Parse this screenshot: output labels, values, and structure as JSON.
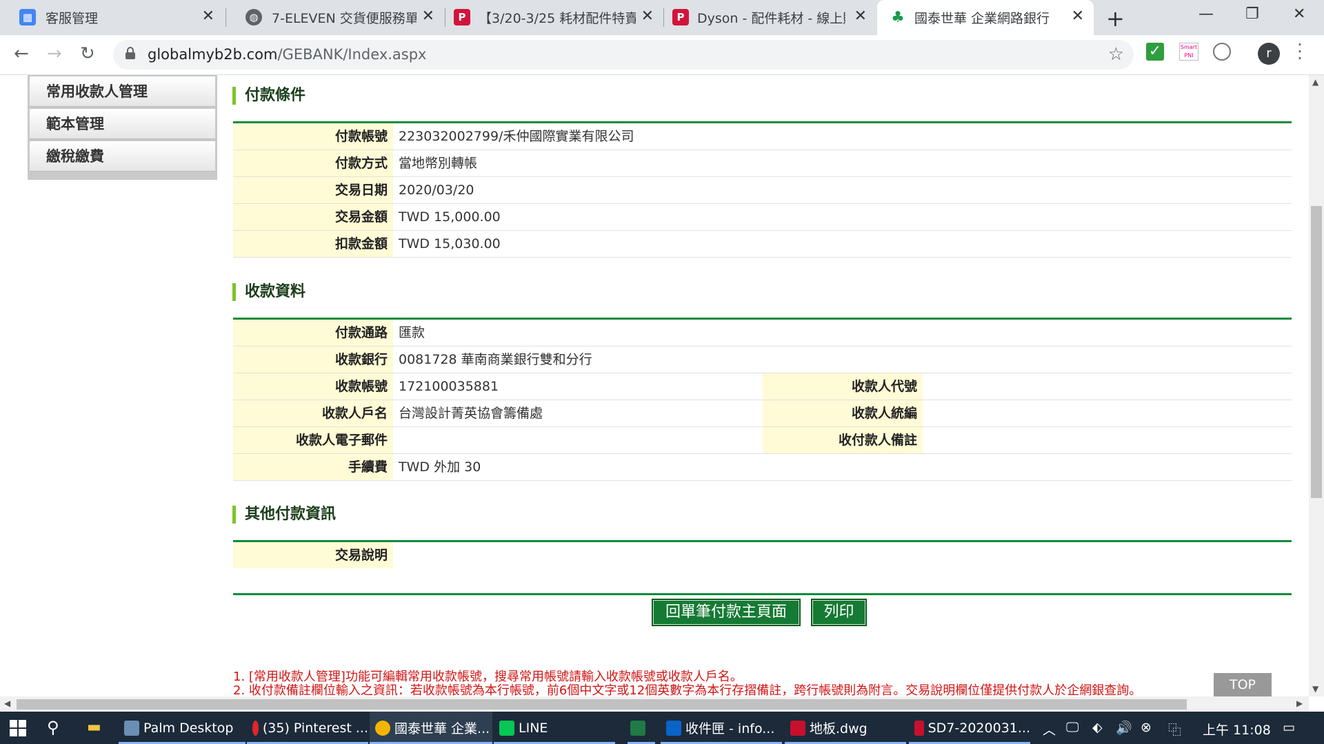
{
  "browser": {
    "tabs": [
      {
        "title": "客服管理",
        "favicon": "calendar-icon",
        "color": "#4285f4"
      },
      {
        "title": "7-ELEVEN 交貨便服務單",
        "favicon": "globe-icon",
        "color": "#5f6368"
      },
      {
        "title": "【3/20-3/25 耗材配件特賣",
        "favicon": "p-logo-icon",
        "color": "#d2143a"
      },
      {
        "title": "Dyson - 配件耗材 - 線上購",
        "favicon": "p-logo-icon",
        "color": "#d2143a"
      },
      {
        "title": "國泰世華 企業網路銀行",
        "favicon": "tree-logo-icon",
        "color": "#1a9b4a",
        "active": true
      }
    ],
    "url_host": "globalmyb2b.com",
    "url_path": "/GEBANK/Index.aspx",
    "avatar_letter": "r",
    "smart_ext": "Smart PNI"
  },
  "sidebar": {
    "items": [
      "常用收款人管理",
      "範本管理",
      "繳稅繳費"
    ]
  },
  "payment_terms": {
    "title": "付款條件",
    "rows": [
      {
        "label": "付款帳號",
        "value": "223032002799/禾仲國際實業有限公司"
      },
      {
        "label": "付款方式",
        "value": "當地幣別轉帳"
      },
      {
        "label": "交易日期",
        "value": "2020/03/20"
      },
      {
        "label": "交易金額",
        "value": "TWD 15,000.00"
      },
      {
        "label": "扣款金額",
        "value": "TWD 15,030.00"
      }
    ]
  },
  "payee_info": {
    "title": "收款資料",
    "channel": {
      "label": "付款通路",
      "value": "匯款"
    },
    "bank": {
      "label": "收款銀行",
      "value": "0081728 華南商業銀行雙和分行"
    },
    "account": {
      "label": "收款帳號",
      "value": "172100035881"
    },
    "payee_code": {
      "label": "收款人代號",
      "value": ""
    },
    "name": {
      "label": "收款人戶名",
      "value": "台灣設計菁英協會籌備處"
    },
    "tax_id": {
      "label": "收款人統編",
      "value": ""
    },
    "email": {
      "label": "收款人電子郵件",
      "value": ""
    },
    "remark": {
      "label": "收付款人備註",
      "value": ""
    },
    "fee": {
      "label": "手續費",
      "value": "TWD 外加 30"
    }
  },
  "other_info": {
    "title": "其他付款資訊",
    "desc": {
      "label": "交易說明",
      "value": ""
    }
  },
  "buttons": {
    "back": "回單筆付款主頁面",
    "print": "列印",
    "top": "TOP"
  },
  "notes": [
    "1. [常用收款人管理]功能可編輯常用收款帳號，搜尋常用帳號請輸入收款帳號或收款人戶名。",
    "2. 收付款備註欄位輸入之資訊：若收款帳號為本行帳號，前6個中文字或12個英數字為本行存摺備註，跨行帳號則為附言。交易說明欄位僅提供付款人於企網銀查詢。"
  ],
  "taskbar": {
    "items": [
      {
        "label": "Palm Desktop",
        "icon": "palm-icon",
        "color": "#6a8fb5"
      },
      {
        "label": "(35) Pinterest ...",
        "icon": "opera-icon",
        "color": "#e0262e"
      },
      {
        "label": "國泰世華 企業...",
        "icon": "chrome-icon",
        "color": "#f4b400"
      },
      {
        "label": "LINE",
        "icon": "line-icon",
        "color": "#06c755"
      },
      {
        "label": "",
        "icon": "excel-icon",
        "color": "#1f7a45"
      },
      {
        "label": "收件匣 - info...",
        "icon": "outlook-icon",
        "color": "#0a64c8"
      },
      {
        "label": "地板.dwg",
        "icon": "autocad-icon",
        "color": "#c8102e"
      },
      {
        "label": "SD7-2020031...",
        "icon": "autocad-icon",
        "color": "#c8102e"
      }
    ],
    "clock": "上午 11:08"
  }
}
